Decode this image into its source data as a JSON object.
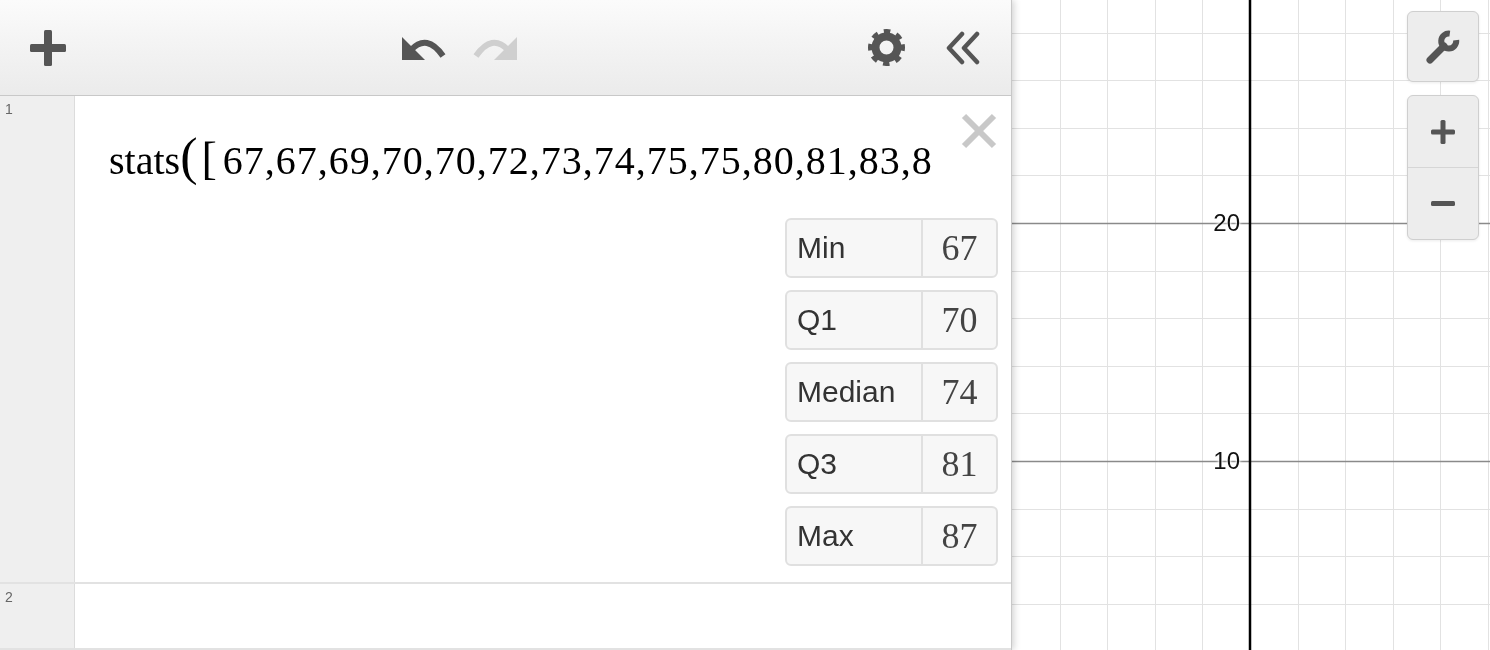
{
  "toolbar": {
    "undo": {
      "disabled": false
    },
    "redo": {
      "disabled": true
    }
  },
  "expressions": [
    {
      "number": "1",
      "kind": "stats",
      "focused": true,
      "function": "stats",
      "open_paren": "(",
      "open_bracket": "[",
      "values": "67,67,69,70,70,72,73,74,75,75,80,81,83,8",
      "stats": [
        {
          "label": "Min",
          "value": "67"
        },
        {
          "label": "Q1",
          "value": "70"
        },
        {
          "label": "Median",
          "value": "74"
        },
        {
          "label": "Q3",
          "value": "81"
        },
        {
          "label": "Max",
          "value": "87"
        }
      ]
    },
    {
      "number": "2",
      "kind": "empty",
      "focused": false
    }
  ],
  "graph": {
    "y_tick_labels": [
      "20",
      "10"
    ]
  }
}
